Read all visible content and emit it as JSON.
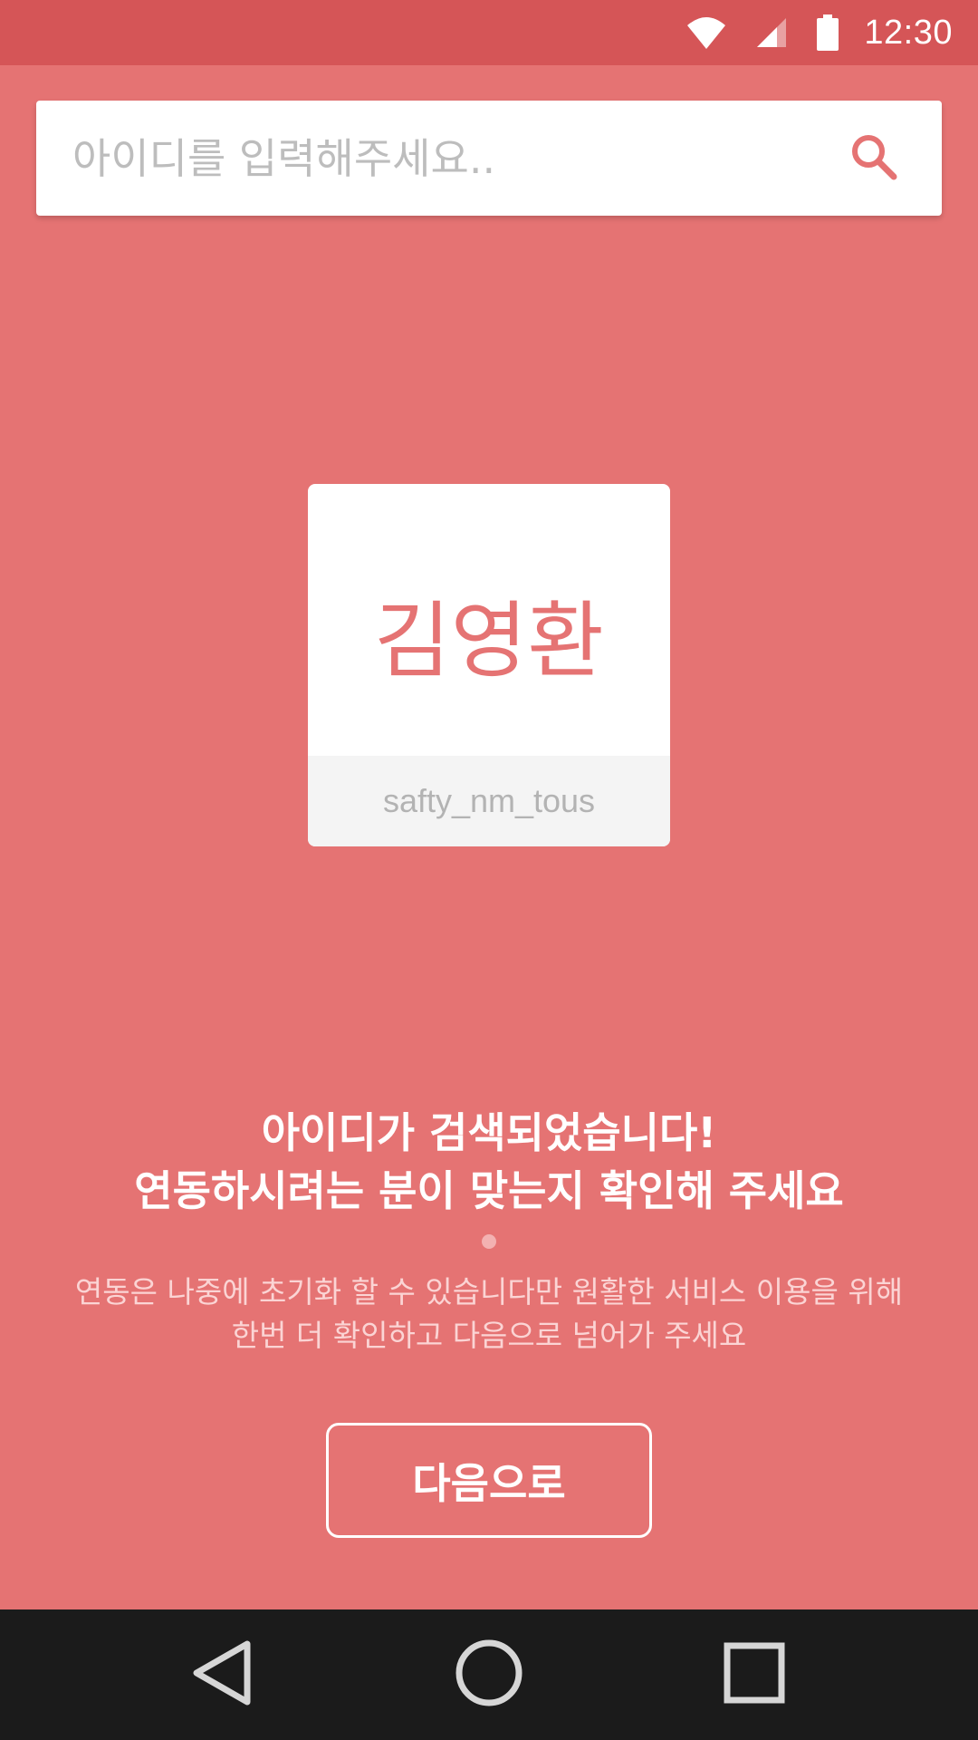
{
  "status_bar": {
    "time": "12:30",
    "icons": [
      "wifi-icon",
      "cellular-signal-icon",
      "battery-icon"
    ]
  },
  "search": {
    "placeholder": "아이디를 입력해주세요..",
    "value": "",
    "icon": "search-icon"
  },
  "profile_card": {
    "name": "김영환",
    "user_id": "safty_nm_tous"
  },
  "message": {
    "headline_line1": "아이디가 검색되었습니다!",
    "headline_line2": "연동하시려는 분이 맞는지 확인해 주세요",
    "subtext_line1": "연동은 나중에 초기화 할 수 있습니다만 원활한 서비스 이용을 위해",
    "subtext_line2": "한번 더 확인하고 다음으로 넘어가 주세요"
  },
  "next_button": {
    "label": "다음으로"
  },
  "nav_bar": {
    "icons": [
      "back-icon",
      "home-icon",
      "recents-icon"
    ]
  },
  "colors": {
    "background": "#e57373",
    "status_bar": "#d55557",
    "accent": "#e57373",
    "nav_bar": "#1b1b1b"
  }
}
